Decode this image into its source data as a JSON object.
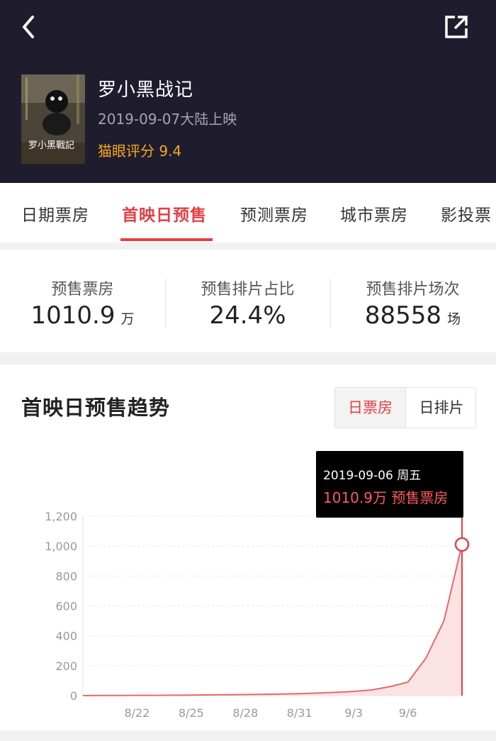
{
  "header": {
    "back_icon": "chevron-left-icon",
    "share_icon": "share-external-icon",
    "movie": {
      "title": "罗小黑战记",
      "release": "2019-09-07大陆上映",
      "score": "猫眼评分 9.4",
      "poster_text": "罗小黑戰記"
    }
  },
  "tabs": [
    {
      "label": "日期票房",
      "active": false
    },
    {
      "label": "首映日预售",
      "active": true
    },
    {
      "label": "预测票房",
      "active": false
    },
    {
      "label": "城市票房",
      "active": false
    },
    {
      "label": "影投票",
      "active": false
    }
  ],
  "stats": [
    {
      "label": "预售票房",
      "value": "1010.9",
      "unit": "万"
    },
    {
      "label": "预售排片占比",
      "value": "24.4%",
      "unit": ""
    },
    {
      "label": "预售排片场次",
      "value": "88558",
      "unit": "场"
    }
  ],
  "chart_section": {
    "title": "首映日预售趋势",
    "toggle": {
      "active": "日票房",
      "inactive": "日排片"
    },
    "tooltip": {
      "date": "2019-09-06 周五",
      "value": "1010.9万 预售票房"
    }
  },
  "colors": {
    "header_bg": "#1f1d2d",
    "accent_red": "#e23f45",
    "score_gold": "#f5a623",
    "area_fill": "#fbe3e4",
    "line": "#e8686c"
  },
  "chart_data": {
    "type": "area",
    "x_ticks": [
      "8/22",
      "8/25",
      "8/28",
      "8/31",
      "9/3",
      "9/6"
    ],
    "y_ticks": [
      "0",
      "200",
      "400",
      "600",
      "800",
      "1,000",
      "1,200"
    ],
    "ylim": [
      0,
      1200
    ],
    "x_start": "2019-08-19",
    "values": [
      0,
      1,
      1,
      2,
      2,
      3,
      4,
      5,
      6,
      7,
      9,
      11,
      13,
      17,
      22,
      28,
      38,
      60,
      90,
      250,
      500,
      1010.9
    ],
    "highlight_index": 21,
    "grid": "horizontal-dashed",
    "series": [
      {
        "name": "预售票房",
        "values": [
          0,
          1,
          1,
          2,
          2,
          3,
          4,
          5,
          6,
          7,
          9,
          11,
          13,
          17,
          22,
          28,
          38,
          60,
          90,
          250,
          500,
          1010.9
        ]
      }
    ]
  }
}
